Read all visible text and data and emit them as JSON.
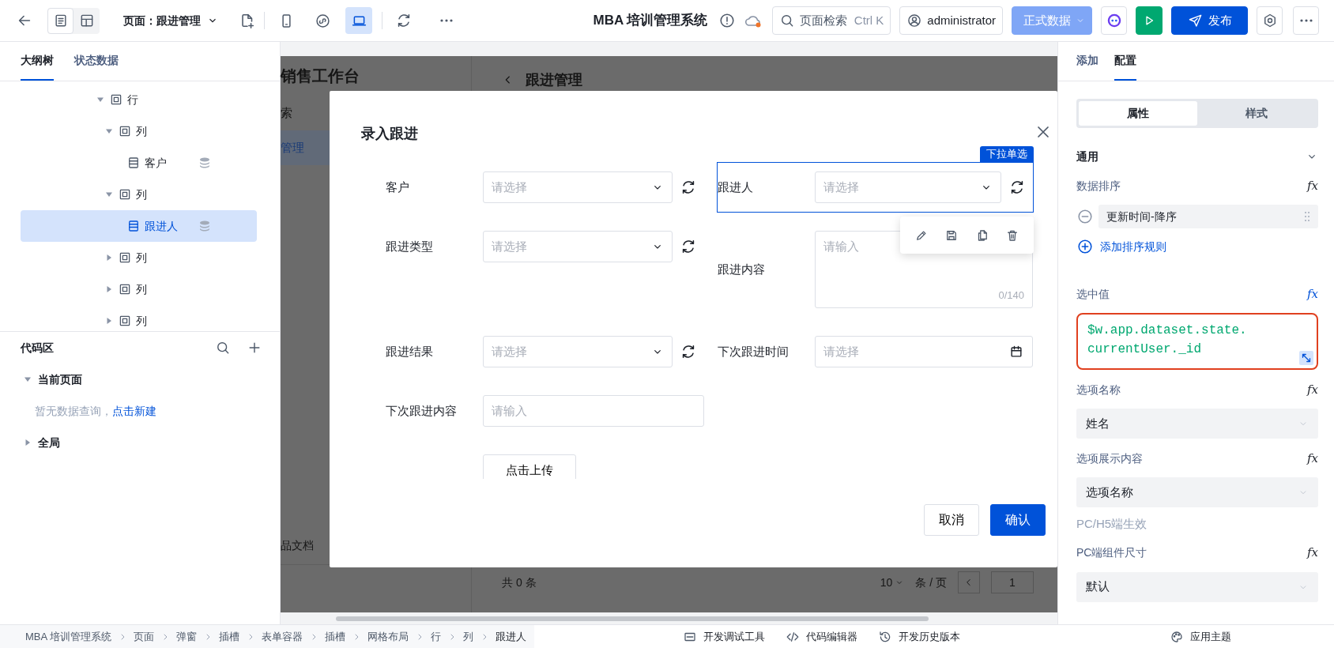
{
  "toolbar": {
    "view_modes": [
      {
        "kind": "page",
        "selected": true
      },
      {
        "kind": "layout",
        "selected": false
      }
    ],
    "page_label": "页面：跟进管理",
    "devices": [
      {
        "kind": "mobile",
        "selected": false
      },
      {
        "kind": "miniprogram",
        "selected": false
      },
      {
        "kind": "desktop",
        "selected": true
      }
    ],
    "app_title": "MBA 培训管理系统",
    "search": {
      "placeholder": "页面检索",
      "shortcut": "Ctrl K"
    },
    "user": "administrator",
    "data_mode": "正式数据",
    "publish": "发布"
  },
  "left_panel": {
    "tabs": [
      {
        "label": "大纲树",
        "selected": true
      },
      {
        "label": "状态数据",
        "selected": false
      }
    ],
    "outline": [
      {
        "label": "行",
        "kind": "container",
        "expanded": true,
        "selected": false,
        "children": [
          {
            "label": "列",
            "kind": "container",
            "expanded": true,
            "selected": false,
            "children": [
              {
                "label": "客户",
                "kind": "field",
                "selected": false
              }
            ]
          },
          {
            "label": "列",
            "kind": "container",
            "expanded": true,
            "selected": false,
            "children": [
              {
                "label": "跟进人",
                "kind": "field",
                "selected": true
              }
            ]
          },
          {
            "label": "列",
            "kind": "container",
            "expanded": false,
            "selected": false
          },
          {
            "label": "列",
            "kind": "container",
            "expanded": false,
            "selected": false
          },
          {
            "label": "列",
            "kind": "container",
            "expanded": false,
            "selected": false
          }
        ]
      }
    ],
    "code_area": {
      "title": "代码区",
      "sections": [
        {
          "label": "当前页面",
          "expanded": true,
          "empty_text": "暂无数据查询，",
          "create_link": "点击新建"
        },
        {
          "label": "全局",
          "expanded": false
        }
      ]
    }
  },
  "canvas": {
    "app": {
      "title": "销售工作台",
      "menu": [
        {
          "label": "索",
          "selected": false
        },
        {
          "label": "管理",
          "selected": true
        }
      ],
      "footer_item": "品文档",
      "page_title": "跟进管理",
      "pagination": {
        "total": "共 0 条",
        "page_size": "10",
        "per_page": "条 / 页",
        "page": "1"
      }
    },
    "dialog": {
      "title": "录入跟进",
      "rows": [
        [
          {
            "label": "客户",
            "kind": "select",
            "placeholder": "请选择",
            "refresh": true,
            "selected": false
          },
          {
            "label": "跟进人",
            "kind": "select",
            "placeholder": "请选择",
            "refresh": true,
            "selected": true,
            "component_type": "下拉单选"
          }
        ],
        [
          {
            "label": "跟进类型",
            "kind": "select",
            "placeholder": "请选择",
            "refresh": true,
            "selected": false
          },
          {
            "label": "跟进内容",
            "kind": "textarea",
            "placeholder": "请输入",
            "counter": "0/140",
            "selected": false
          }
        ],
        [
          {
            "label": "跟进结果",
            "kind": "select",
            "placeholder": "请选择",
            "refresh": true,
            "selected": false
          },
          {
            "label": "下次跟进时间",
            "kind": "date",
            "placeholder": "请选择",
            "selected": false
          }
        ],
        [
          {
            "label": "下次跟进内容",
            "kind": "input",
            "placeholder": "请输入",
            "selected": false
          }
        ],
        [
          {
            "kind": "upload",
            "button": "点击上传",
            "selected": false
          }
        ]
      ],
      "cancel": "取消",
      "confirm": "确认"
    }
  },
  "right_panel": {
    "tabs": [
      {
        "label": "添加",
        "selected": false
      },
      {
        "label": "配置",
        "selected": true
      }
    ],
    "segments": [
      {
        "label": "属性",
        "selected": true
      },
      {
        "label": "样式",
        "selected": false
      }
    ],
    "section": {
      "title": "通用",
      "expanded": true
    },
    "properties": [
      {
        "kind": "sort",
        "label": "数据排序",
        "formula": "fx",
        "bound": false,
        "rules": [
          "更新时间-降序"
        ],
        "add_rule": "添加排序规则"
      },
      {
        "kind": "code",
        "label": "选中值",
        "formula": "fx",
        "bound": true,
        "value": "$w.app.dataset.state.currentUser._id",
        "highlighted": true
      },
      {
        "kind": "select",
        "label": "选项名称",
        "formula": "fx",
        "bound": false,
        "value": "姓名"
      },
      {
        "kind": "select",
        "label": "选项展示内容",
        "formula": "fx",
        "bound": false,
        "value": "选项名称",
        "hint": "PC/H5端生效"
      },
      {
        "kind": "select",
        "label": "PC端组件尺寸",
        "formula": "fx",
        "bound": false,
        "value": "默认"
      }
    ]
  },
  "status_bar": {
    "breadcrumb": [
      "MBA 培训管理系统",
      "页面",
      "弹窗",
      "插槽",
      "表单容器",
      "插槽",
      "网格布局",
      "行",
      "列",
      "跟进人"
    ],
    "tools": [
      {
        "kind": "debug",
        "label": "开发调试工具"
      },
      {
        "kind": "code",
        "label": "代码编辑器"
      },
      {
        "kind": "history",
        "label": "开发历史版本"
      }
    ],
    "theme": "应用主题"
  }
}
